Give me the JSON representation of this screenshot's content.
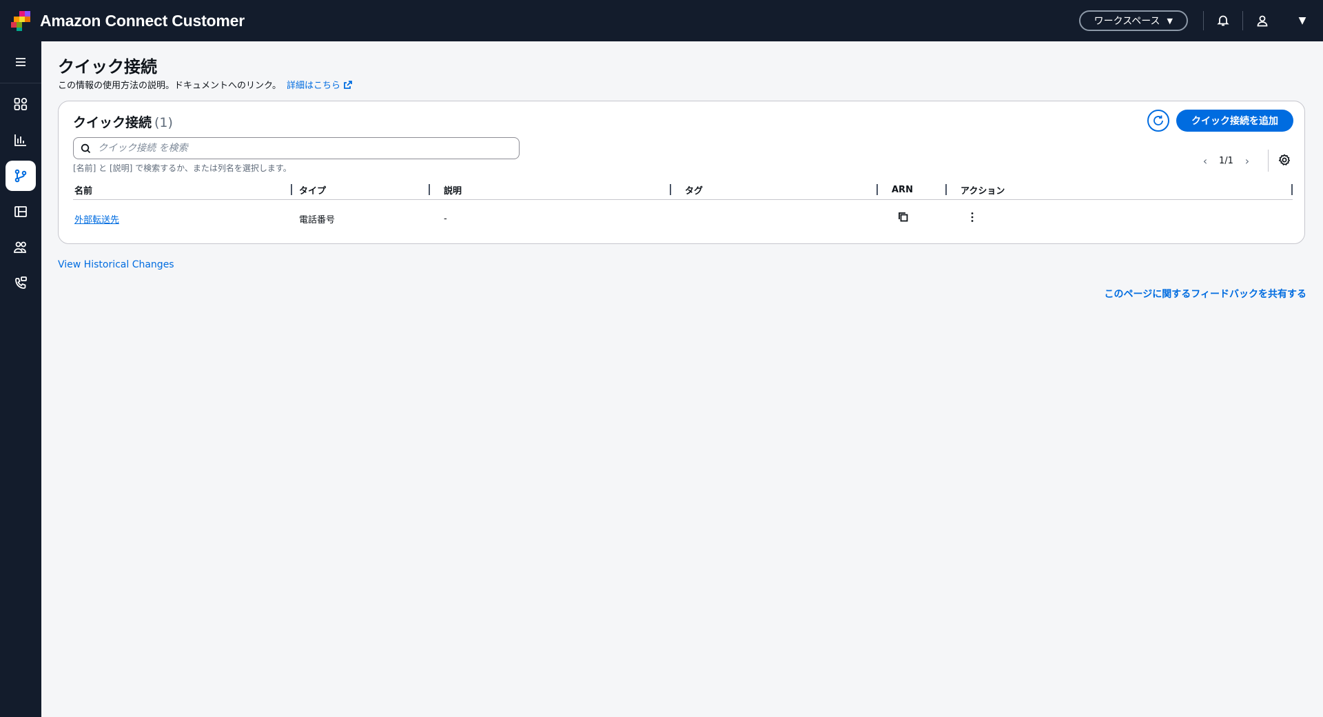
{
  "header": {
    "brand_title": "Amazon Connect Customer",
    "workspace_label": "ワークスペース",
    "icons": [
      "notification-bell-icon",
      "user-icon",
      "caret-down-icon"
    ]
  },
  "sidebar": {
    "menu_icon": "hamburger-icon",
    "items": [
      {
        "icon": "dashboard-grid-icon",
        "active": false
      },
      {
        "icon": "analytics-chart-icon",
        "active": false
      },
      {
        "icon": "routing-flow-icon",
        "active": true
      },
      {
        "icon": "layout-panel-icon",
        "active": false
      },
      {
        "icon": "users-group-icon",
        "active": false
      },
      {
        "icon": "phone-channels-icon",
        "active": false
      }
    ]
  },
  "page": {
    "title": "クイック接続",
    "description": "この情報の使用方法の説明。ドキュメントへのリンク。",
    "learn_more": "詳細はこちら"
  },
  "panel": {
    "title": "クイック接続",
    "count": "(1)",
    "add_button": "クイック接続を追加",
    "search_placeholder": "クイック接続 を検索",
    "search_hint": "[名前] と [説明] で検索するか、または列名を選択します。",
    "pagination": "1/1"
  },
  "table": {
    "columns": [
      "名前",
      "タイプ",
      "説明",
      "タグ",
      "ARN",
      "アクション"
    ],
    "rows": [
      {
        "name": "外部転送先",
        "type": "電話番号",
        "description": "-",
        "tags": "",
        "arn_icon": "copy-icon",
        "action_icon": "more-vertical-icon"
      }
    ]
  },
  "footer": {
    "history_link": "View Historical Changes",
    "feedback_link": "このページに関するフィードバックを共有する"
  },
  "colors": {
    "header_bg": "#131c2c",
    "accent": "#006ce0",
    "page_bg": "#f5f6f8"
  }
}
